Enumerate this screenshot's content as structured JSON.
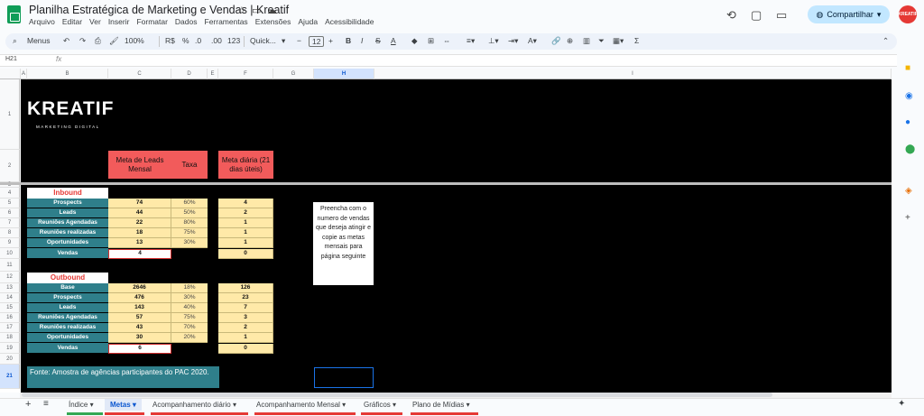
{
  "doc_title": "Planilha Estratégica de Marketing e Vendas | Kreatif",
  "menu": [
    "Arquivo",
    "Editar",
    "Ver",
    "Inserir",
    "Formatar",
    "Dados",
    "Ferramentas",
    "Extensões",
    "Ajuda",
    "Acessibilidade"
  ],
  "share_label": "Compartilhar",
  "avatar_text": "KREATIF",
  "toolbar": {
    "menus": "Menus",
    "zoom": "100%",
    "currency": "R$",
    "percent": "%",
    "dec_less": ".0",
    "dec_more": ".00",
    "numfmt": "123",
    "font": "Quick...",
    "font_size": "12"
  },
  "formula_bar": {
    "cell_ref": "H21",
    "fx": "fx",
    "content": ""
  },
  "columns": [
    "A",
    "B",
    "C",
    "D",
    "E",
    "F",
    "G",
    "H",
    "I"
  ],
  "rows": [
    "1",
    "2",
    "3",
    "4",
    "5",
    "6",
    "7",
    "8",
    "9",
    "10",
    "11",
    "12",
    "13",
    "14",
    "15",
    "16",
    "17",
    "18",
    "19",
    "20",
    "21"
  ],
  "brand": {
    "name": "KREATIF",
    "tagline": "MARKETING DIGITAL"
  },
  "headers": {
    "meta_leads": "Meta de Leads Mensal",
    "taxa": "Taxa",
    "meta_diaria": "Meta diária (21 dias úteis)"
  },
  "inbound": {
    "title": "Inbound",
    "rows": [
      {
        "label": "Prospects",
        "meta": "74",
        "taxa": "60%",
        "diaria": "4"
      },
      {
        "label": "Leads",
        "meta": "44",
        "taxa": "50%",
        "diaria": "2"
      },
      {
        "label": "Reuniões Agendadas",
        "meta": "22",
        "taxa": "80%",
        "diaria": "1"
      },
      {
        "label": "Reuniões realizadas",
        "meta": "18",
        "taxa": "75%",
        "diaria": "1"
      },
      {
        "label": "Oportunidades",
        "meta": "13",
        "taxa": "30%",
        "diaria": "1"
      }
    ],
    "vendas": {
      "label": "Vendas",
      "meta": "4",
      "diaria": "0"
    }
  },
  "outbound": {
    "title": "Outbound",
    "rows": [
      {
        "label": "Base",
        "meta": "2646",
        "taxa": "18%",
        "diaria": "126"
      },
      {
        "label": "Prospects",
        "meta": "476",
        "taxa": "30%",
        "diaria": "23"
      },
      {
        "label": "Leads",
        "meta": "143",
        "taxa": "40%",
        "diaria": "7"
      },
      {
        "label": "Reuniões Agendadas",
        "meta": "57",
        "taxa": "75%",
        "diaria": "3"
      },
      {
        "label": "Reuniões realizadas",
        "meta": "43",
        "taxa": "70%",
        "diaria": "2"
      },
      {
        "label": "Oportunidades",
        "meta": "30",
        "taxa": "20%",
        "diaria": "1"
      }
    ],
    "vendas": {
      "label": "Vendas",
      "meta": "6",
      "diaria": "0"
    }
  },
  "note": "Preencha com o numero de vendas que deseja atingir e copie as metas mensais para página seguinte",
  "fonte": "Fonte: Amostra de agências participantes do PAC 2020.",
  "tabs": [
    {
      "label": "Índice ▾",
      "color": "#34a853"
    },
    {
      "label": "Metas ▾",
      "color": "#e53935"
    },
    {
      "label": "Acompanhamento diário ▾",
      "color": "#e53935"
    },
    {
      "label": "Acompanhamento Mensal ▾",
      "color": "#e53935"
    },
    {
      "label": "Gráficos ▾",
      "color": "#e53935"
    },
    {
      "label": "Plano de Mídias ▾",
      "color": "#e53935"
    }
  ],
  "colors": {
    "accent": "#0b57d0",
    "teal": "#2f7f8b",
    "red": "#f25b5b",
    "yellow": "#ffe9a8"
  }
}
